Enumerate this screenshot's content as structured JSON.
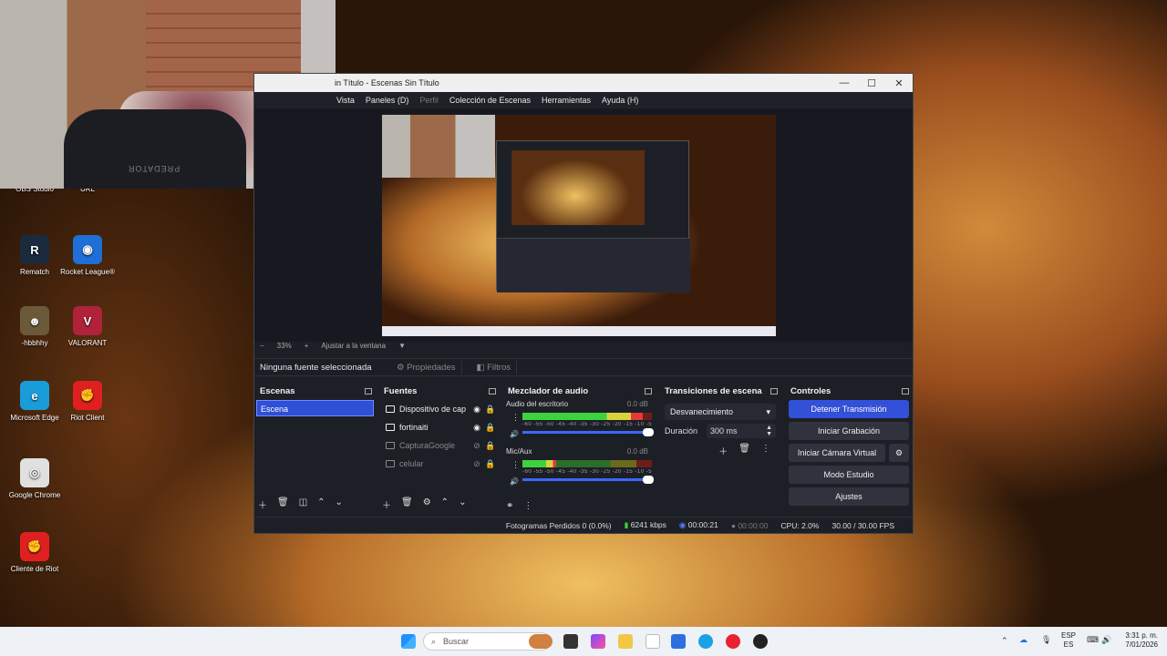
{
  "desktop": {
    "icons": [
      {
        "name": "OBS Studio",
        "color": "#3a3d46",
        "glyph": ""
      },
      {
        "name": "URL",
        "color": "#3a3d46",
        "glyph": ""
      },
      {
        "name": "Rematch",
        "color": "#1b2a3c",
        "glyph": "R"
      },
      {
        "name": "Rocket League®",
        "color": "#1f6fd6",
        "glyph": "◉"
      },
      {
        "name": "-hbbhhy",
        "color": "#6b5a3a",
        "glyph": "☻"
      },
      {
        "name": "VALORANT",
        "color": "#b0223a",
        "glyph": "V"
      },
      {
        "name": "Microsoft Edge",
        "color": "#1a9cd8",
        "glyph": "e"
      },
      {
        "name": "Riot Client",
        "color": "#e02020",
        "glyph": "✊"
      },
      {
        "name": "Google Chrome",
        "color": "#e0e0e0",
        "glyph": "◎"
      },
      {
        "name": "Cliente de Riot",
        "color": "#e02020",
        "glyph": "✊"
      }
    ]
  },
  "webcam": {
    "chair_text": "PREDATOR"
  },
  "obs": {
    "window_title": "Sin Título - Escenas Sin Título",
    "title_visible": "in Título - Escenas Sin Título",
    "window_controls": {
      "minimize": "—",
      "maximize": "☐",
      "close": "✕"
    },
    "menu": [
      {
        "label": "Vista",
        "dim": false
      },
      {
        "label": "Paneles (D)",
        "dim": false
      },
      {
        "label": "Perfil",
        "dim": true
      },
      {
        "label": "Colección de Escenas",
        "dim": false
      },
      {
        "label": "Herramientas",
        "dim": false
      },
      {
        "label": "Ayuda (H)",
        "dim": false
      }
    ],
    "zoom": {
      "minus": "−",
      "value": "33%",
      "plus": "+",
      "fit": "Ajustar a la ventana",
      "arrow": "▼"
    },
    "toolbar": {
      "no_source": "Ninguna fuente seleccionada",
      "properties": "⚙ Propiedades",
      "filters": "◧ Filtros"
    },
    "scenes": {
      "title": "Escenas",
      "items": [
        "Escena"
      ]
    },
    "sources": {
      "title": "Fuentes",
      "items": [
        {
          "label": "Dispositivo de cap",
          "visible": true
        },
        {
          "label": "fortinaiti",
          "visible": true
        },
        {
          "label": "CapturaGoogle",
          "visible": false
        },
        {
          "label": "celular",
          "visible": false
        }
      ]
    },
    "mixer": {
      "title": "Mezclador de audio",
      "scale": "-60 -55 -50 -45 -40 -35 -30 -25 -20 -15 -10 -5 0",
      "channels": [
        {
          "name": "Audio del escritorio",
          "db": "0.0 dB",
          "level": 0.93
        },
        {
          "name": "Mic/Aux",
          "db": "0.0 dB",
          "level": 0.26
        }
      ]
    },
    "transitions": {
      "title": "Transiciones de escena",
      "selected": "Desvanecimiento",
      "duration_label": "Duración",
      "duration_value": "300 ms"
    },
    "controls": {
      "title": "Controles",
      "stop_stream": "Detener Transmisión",
      "start_recording": "Iniciar Grabación",
      "virtual_cam": "Iniciar Cámara Virtual",
      "studio_mode": "Modo Estudio",
      "settings": "Ajustes"
    },
    "status": {
      "dropped": "Fotogramas Perdidos 0 (0.0%)",
      "bitrate": "6241 kbps",
      "stream_time": "00:00:21",
      "rec_time": "00:00:00",
      "cpu": "CPU: 2.0%",
      "fps": "30.00 / 30.00 FPS"
    }
  },
  "taskbar": {
    "search_placeholder": "Buscar",
    "lang_top": "ESP",
    "lang_bottom": "ES",
    "time": "3:31 p. m.",
    "date": "7/01/2026"
  }
}
